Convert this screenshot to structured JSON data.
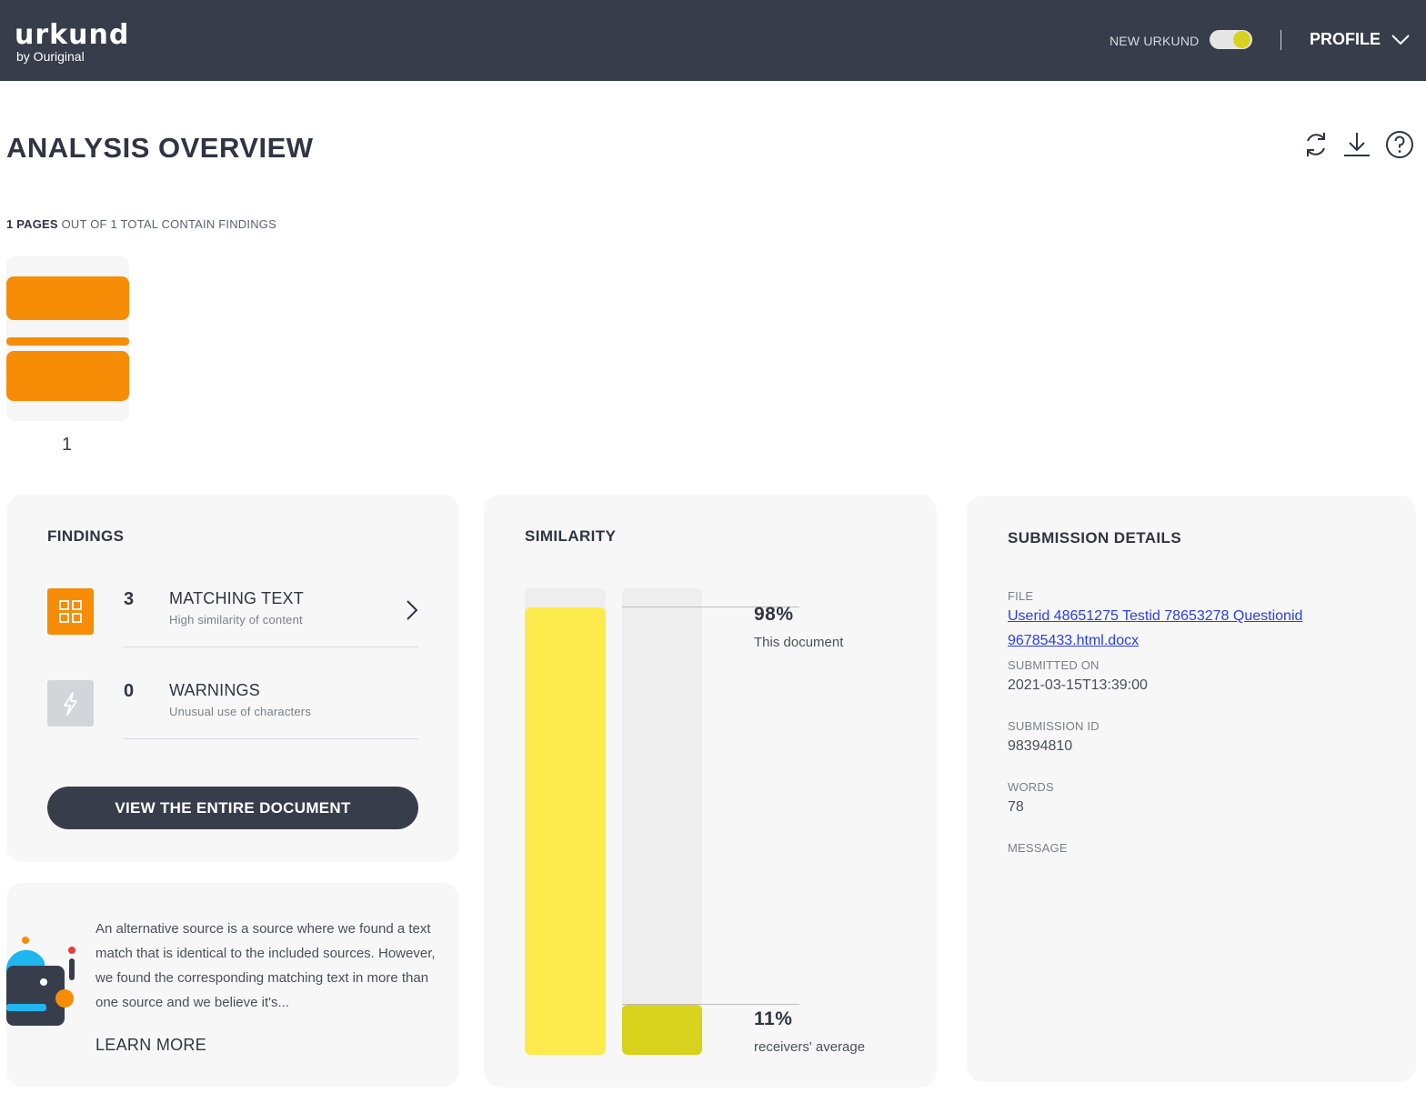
{
  "header": {
    "logo_main": "urkund",
    "logo_sub": "by Ouriginal",
    "new_urkund_label": "NEW URKUND",
    "new_urkund_enabled": true,
    "profile_label": "PROFILE",
    "bg_color": "#373d4a"
  },
  "page": {
    "title": "ANALYSIS OVERVIEW",
    "toolbar_icons": [
      "refresh-icon",
      "download-icon",
      "help-icon"
    ],
    "pages_count": "1 PAGES",
    "pages_rest": " OUT OF 1 TOTAL CONTAIN FINDINGS",
    "thumbnail_page": "1"
  },
  "findings": {
    "title": "FINDINGS",
    "items": [
      {
        "count": "3",
        "title": "MATCHING TEXT",
        "subtitle": "High similarity of content",
        "icon": "grid-icon",
        "color": "#f78c06"
      },
      {
        "count": "0",
        "title": "WARNINGS",
        "subtitle": "Unusual use of characters",
        "icon": "lightning-icon",
        "color": "#d3d5da"
      }
    ],
    "button_label": "VIEW THE ENTIRE DOCUMENT"
  },
  "info": {
    "text": "An alternative source is a source where we found a text match that is identical to the included sources. However, we found the corresponding matching text in more than one source and we believe it's...",
    "learn_more": "LEARN MORE"
  },
  "similarity": {
    "title": "SIMILARITY",
    "document_pct_label": "98%",
    "document_label": "This document",
    "average_pct_label": "11%",
    "average_label": "receivers' average",
    "document_value": 98,
    "average_value": 11,
    "document_color": "#fdea4d",
    "average_color": "#d9d21c"
  },
  "submission": {
    "title": "SUBMISSION DETAILS",
    "file_label": "FILE",
    "file_value": "Userid 48651275 Testid 78653278 Questionid 96785433.html.docx",
    "submitted_label": "SUBMITTED ON",
    "submitted_value": "2021-03-15T13:39:00",
    "id_label": "SUBMISSION ID",
    "id_value": "98394810",
    "words_label": "WORDS",
    "words_value": "78",
    "message_label": "MESSAGE"
  }
}
